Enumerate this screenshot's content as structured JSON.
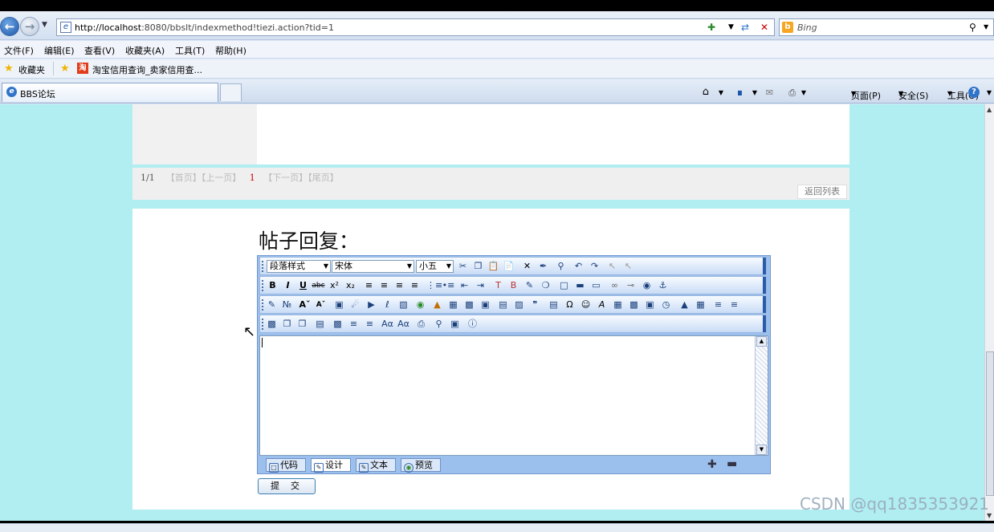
{
  "address_bar": {
    "url_host": "http://localhost",
    "url_rest": ":8080/bbslt/indexmethod!tiezi.action?tid=1",
    "search_placeholder": "Bing"
  },
  "menu": [
    "文件(F)",
    "编辑(E)",
    "查看(V)",
    "收藏夹(A)",
    "工具(T)",
    "帮助(H)"
  ],
  "favorites": {
    "label": "收藏夹",
    "item": "淘宝信用查询_卖家信用查..."
  },
  "tabs": [
    {
      "label": "BBS论坛"
    }
  ],
  "command_bar": {
    "page": "页面(P)",
    "safety": "安全(S)",
    "tools": "工具(O)"
  },
  "pager": {
    "fraction": "1/1",
    "first": "【首页】",
    "prev": "【上一页】",
    "current": "1",
    "next": "【下一页】",
    "last": "【尾页】",
    "back_to_list": "返回列表"
  },
  "reply": {
    "title": "帖子回复："
  },
  "editor": {
    "paragraph_style": "段落样式",
    "font": "宋体",
    "size": "小五",
    "modes": [
      {
        "label": "代码",
        "icon": "code-icon"
      },
      {
        "label": "设计",
        "icon": "design-icon",
        "active": true
      },
      {
        "label": "文本",
        "icon": "text-icon"
      },
      {
        "label": "预览",
        "icon": "preview-icon"
      }
    ],
    "submit": "提交"
  },
  "watermark": "CSDN @qq1835353921",
  "colors": {
    "page_background": "#b0eef2",
    "editor_toolbar": "#9cc0ee",
    "pager_current": "#cc0000"
  }
}
